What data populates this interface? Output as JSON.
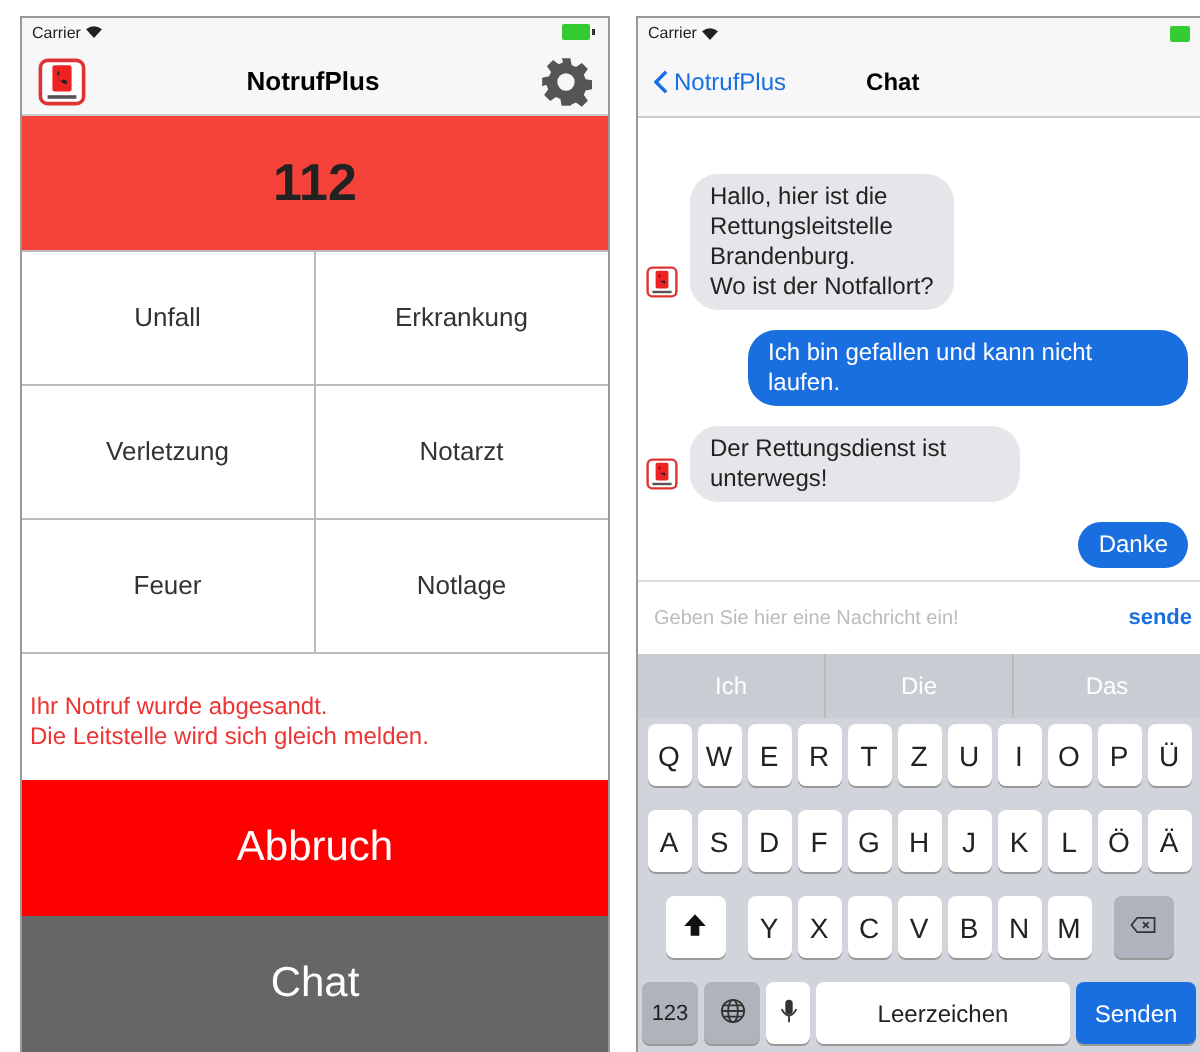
{
  "left": {
    "carrier": "Carrier",
    "title": "NotrufPlus",
    "number": "112",
    "options": [
      {
        "label": "Unfall"
      },
      {
        "label": "Erkrankung"
      },
      {
        "label": "Verletzung"
      },
      {
        "label": "Notarzt"
      },
      {
        "label": "Feuer"
      },
      {
        "label": "Notlage"
      }
    ],
    "notice": [
      "Ihr Notruf wurde abgesandt.",
      "Die Leitstelle wird sich gleich melden."
    ],
    "buttons": [
      {
        "label": "Abbruch",
        "kind": "cancel"
      },
      {
        "label": "Chat",
        "kind": "chat"
      }
    ]
  },
  "right": {
    "carrier": "Carrier",
    "back": "NotrufPlus",
    "title": "Chat",
    "messages": [
      {
        "text": "Hallo, hier ist die\nRettungsleitstelle\nBrandenburg.\nWo ist der Notfallort?",
        "kind": "incoming"
      },
      {
        "text": "Ich bin gefallen und kann nicht laufen.",
        "kind": "outgoing"
      },
      {
        "text": "Der Rettungsdienst ist unterwegs!",
        "kind": "incoming"
      },
      {
        "text": "Danke",
        "kind": "outgoing"
      }
    ],
    "input": {
      "placeholder": "Geben Sie hier eine Nachricht ein!",
      "send": "sende"
    },
    "suggestions": [
      "Ich",
      "Die",
      "Das"
    ],
    "keyboard": {
      "top_row": [
        "Q",
        "W",
        "E",
        "R",
        "T",
        "Z",
        "U",
        "I",
        "O",
        "P",
        "Ü"
      ],
      "middle_row": [
        "A",
        "S",
        "D",
        "F",
        "G",
        "H",
        "J",
        "K",
        "L",
        "Ö",
        "Ä"
      ],
      "bottom_row": [
        "Y",
        "X",
        "C",
        "V",
        "B",
        "N",
        "M"
      ],
      "numbers": "123",
      "space": "Leerzeichen",
      "return": "Senden"
    }
  }
}
